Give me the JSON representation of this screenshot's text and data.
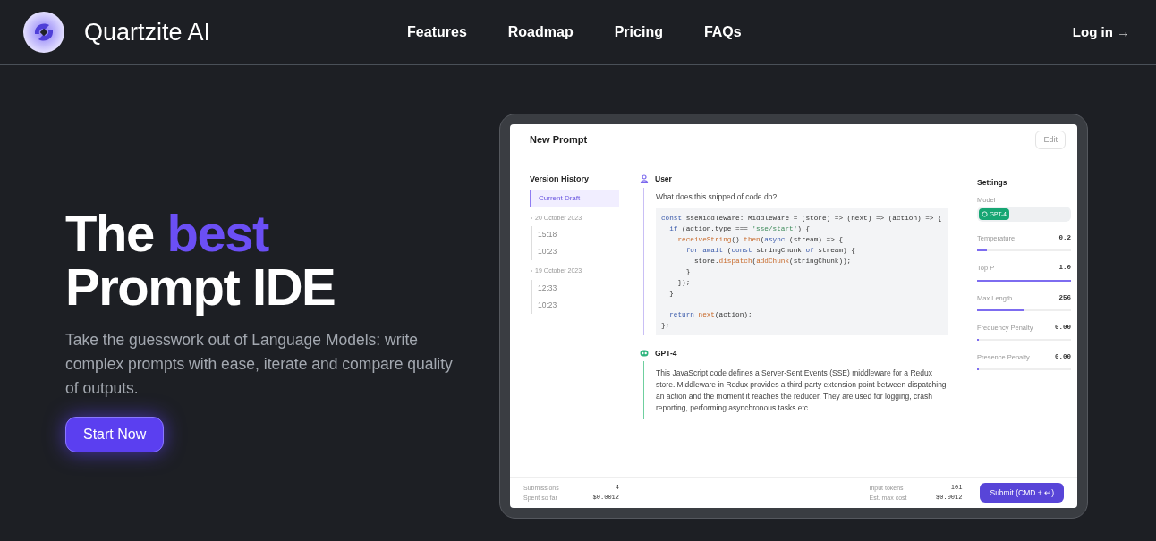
{
  "nav": {
    "brand": "Quartzite AI",
    "links": [
      "Features",
      "Roadmap",
      "Pricing",
      "FAQs"
    ],
    "login": "Log in →"
  },
  "hero": {
    "headline": [
      [
        {
          "text": "The ",
          "accent": false
        },
        {
          "text": "best",
          "accent": true
        }
      ],
      [
        {
          "text": "Prompt IDE",
          "accent": false
        }
      ]
    ],
    "subtitle": "Take the guesswork out of Language Models: write complex prompts with ease, iterate and compare quality of outputs.",
    "cta": "Start Now"
  },
  "editor": {
    "title": "New Prompt",
    "edit_button": "Edit",
    "history": {
      "title": "Version History",
      "current": {
        "label": "Current Draft",
        "selected": true
      },
      "groups": [
        {
          "date": "20 October 2023",
          "items": [
            {
              "label": "15:18",
              "selected": false
            },
            {
              "label": "10:23",
              "selected": false
            }
          ]
        },
        {
          "date": "19 October 2023",
          "items": [
            {
              "label": "12:33",
              "selected": false
            },
            {
              "label": "10:23",
              "selected": false
            }
          ]
        }
      ]
    },
    "messages": [
      {
        "kind": "user",
        "author": "User",
        "text": "What does this snipped of code do?",
        "code": [
          {
            "tokens": [
              {
                "text": "const",
                "kind": "keyword"
              },
              {
                "text": " sseMiddleware: Middleware = (store) => (next) => (action) => {",
                "kind": "plain"
              }
            ]
          },
          {
            "tokens": [
              {
                "text": "  if",
                "kind": "keyword"
              },
              {
                "text": " (action.type === ",
                "kind": "plain"
              },
              {
                "text": "'sse/start'",
                "kind": "string"
              },
              {
                "text": ") {",
                "kind": "plain"
              }
            ]
          },
          {
            "tokens": [
              {
                "text": "    receiveString",
                "kind": "func"
              },
              {
                "text": "().",
                "kind": "plain"
              },
              {
                "text": "then",
                "kind": "func"
              },
              {
                "text": "(",
                "kind": "plain"
              },
              {
                "text": "async",
                "kind": "keyword"
              },
              {
                "text": " (stream) => {",
                "kind": "plain"
              }
            ]
          },
          {
            "tokens": [
              {
                "text": "      for await",
                "kind": "keyword"
              },
              {
                "text": " (",
                "kind": "plain"
              },
              {
                "text": "const",
                "kind": "keyword"
              },
              {
                "text": " stringChunk ",
                "kind": "plain"
              },
              {
                "text": "of",
                "kind": "keyword"
              },
              {
                "text": " stream) {",
                "kind": "plain"
              }
            ]
          },
          {
            "tokens": [
              {
                "text": "        store.",
                "kind": "plain"
              },
              {
                "text": "dispatch",
                "kind": "func"
              },
              {
                "text": "(",
                "kind": "plain"
              },
              {
                "text": "addChunk",
                "kind": "func"
              },
              {
                "text": "(stringChunk));",
                "kind": "plain"
              }
            ]
          },
          {
            "tokens": [
              {
                "text": "      }",
                "kind": "plain"
              }
            ]
          },
          {
            "tokens": [
              {
                "text": "    });",
                "kind": "plain"
              }
            ]
          },
          {
            "tokens": [
              {
                "text": "  }",
                "kind": "plain"
              }
            ]
          },
          {
            "gap_before": true,
            "tokens": [
              {
                "text": "  return",
                "kind": "keyword"
              },
              {
                "text": " next",
                "kind": "func"
              },
              {
                "text": "(action);",
                "kind": "plain"
              }
            ]
          },
          {
            "tokens": [
              {
                "text": "};",
                "kind": "plain"
              }
            ]
          }
        ]
      },
      {
        "kind": "assistant",
        "author": "GPT-4",
        "text": "This JavaScript code defines a Server-Sent Events (SSE) middleware for a Redux store. Middleware in Redux provides a third-party extension point between dispatching an action and the moment it reaches the reducer. They are used for logging, crash reporting, performing asynchronous tasks etc."
      }
    ],
    "settings": {
      "title": "Settings",
      "model_label": "Model",
      "model": "GPT-4",
      "sliders": [
        {
          "label": "Temperature",
          "value": "0.2",
          "level": 0.1
        },
        {
          "label": "Top P",
          "value": "1.0",
          "level": 1
        },
        {
          "label": "Max Length",
          "value": "256",
          "level": 0.5
        },
        {
          "label": "Frequency Penalty",
          "value": "0.00",
          "level": 0
        },
        {
          "label": "Presence Penalty",
          "value": "0.00",
          "level": 0
        }
      ]
    },
    "footer": {
      "left": [
        {
          "label": "Submissions",
          "value": "4"
        },
        {
          "label": "Spent so far",
          "value": "$0.0012"
        }
      ],
      "right": [
        {
          "label": "Input tokens",
          "value": "101"
        },
        {
          "label": "Est. max cost",
          "value": "$0.0012"
        }
      ],
      "submit": "Submit (CMD + ↩)"
    }
  }
}
